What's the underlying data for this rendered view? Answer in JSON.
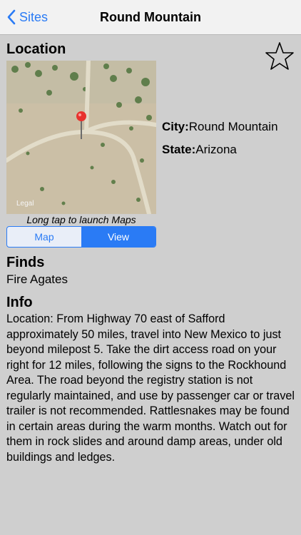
{
  "nav": {
    "back_label": "Sites",
    "title": "Round Mountain"
  },
  "location": {
    "heading": "Location",
    "map_caption": "Long tap to launch Maps",
    "map_watermark": "Legal",
    "segments": [
      "Map",
      "View"
    ],
    "selected_segment": "View",
    "city_label": "City:",
    "city_value": "Round Mountain",
    "state_label": "State:",
    "state_value": "Arizona"
  },
  "finds": {
    "heading": "Finds",
    "value": "Fire Agates"
  },
  "info": {
    "heading": "Info",
    "text": "Location: From Highway 70 east of Safford approximately 50 miles, travel into New Mexico to just beyond milepost 5. Take the dirt access road on your right for 12 miles, following the signs to the Rockhound Area. The road beyond the registry station is not regularly maintained, and use by passenger car or travel trailer is not recommended. Rattlesnakes may be found in certain areas during the warm months.  Watch out for them in rock slides and around damp areas, under old buildings and ledges."
  },
  "colors": {
    "accent": "#2a7bf5",
    "background": "#cfcfcf",
    "navbar": "#f2f2f2",
    "pin": "#e8322e"
  }
}
